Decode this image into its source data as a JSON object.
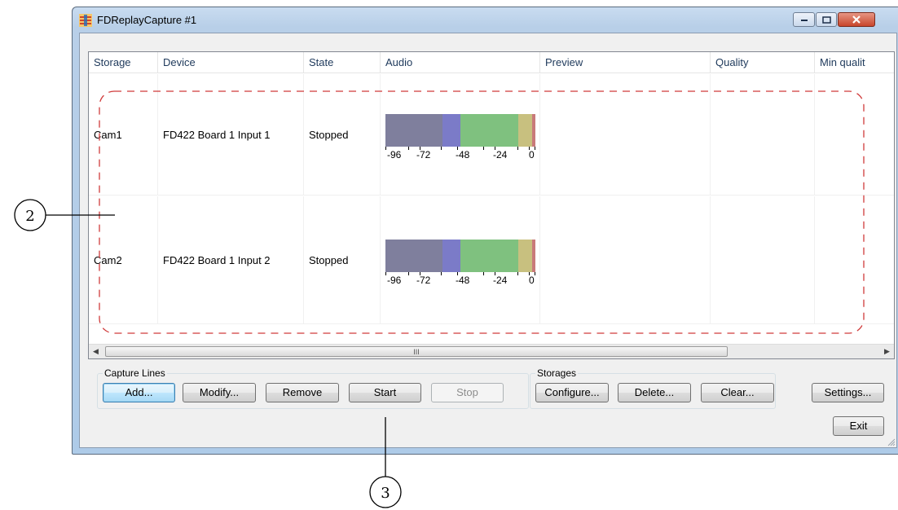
{
  "window": {
    "title": "FDReplayCapture #1",
    "accent": "#c8452b"
  },
  "list": {
    "columns": [
      "Storage",
      "Device",
      "State",
      "Audio",
      "Preview",
      "Quality",
      "Min qualit"
    ],
    "rows": [
      {
        "storage": "Cam1",
        "device": "FD422 Board 1 Input 1",
        "state": "Stopped"
      },
      {
        "storage": "Cam2",
        "device": "FD422 Board 1 Input 2",
        "state": "Stopped"
      }
    ],
    "meter_scale": [
      "-96",
      "-72",
      "-48",
      "-24",
      "0"
    ],
    "meter_colors": [
      "#7f7f9d",
      "#7b7bc8",
      "#7fc17f",
      "#c8c07f",
      "#c97a7a"
    ]
  },
  "scrollbar": {
    "thumb_grip": "III"
  },
  "capture_lines": {
    "label": "Capture Lines",
    "add": "Add...",
    "modify": "Modify...",
    "remove": "Remove",
    "start": "Start",
    "stop": "Stop"
  },
  "storages": {
    "label": "Storages",
    "configure": "Configure...",
    "delete": "Delete...",
    "clear": "Clear..."
  },
  "side_buttons": {
    "settings": "Settings...",
    "exit": "Exit"
  },
  "callouts": {
    "rows_marker": "2",
    "start_marker": "3",
    "color": "#d03b3b"
  }
}
